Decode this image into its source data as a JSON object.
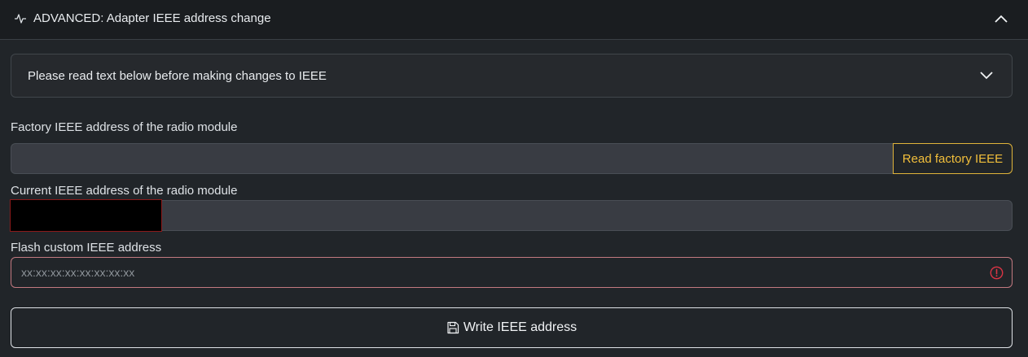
{
  "header": {
    "title": "ADVANCED: Adapter IEEE address change",
    "icon": "activity-pulse-icon",
    "toggle_icon": "chevron-up-icon"
  },
  "notice": {
    "text": "Please read text below before making changes to IEEE",
    "toggle_icon": "chevron-down-icon"
  },
  "factory": {
    "label": "Factory IEEE address of the radio module",
    "value": "",
    "button_label": "Read factory IEEE"
  },
  "current": {
    "label": "Current IEEE address of the radio module",
    "value": ""
  },
  "flash": {
    "label": "Flash custom IEEE address",
    "placeholder": "xx:xx:xx:xx:xx:xx:xx:xx",
    "value": "",
    "invalid": true
  },
  "write": {
    "button_label": "Write IEEE address",
    "icon": "floppy-disk-icon"
  },
  "colors": {
    "background": "#212529",
    "header": "#1a1d20",
    "warning": "#f2bf3b",
    "danger": "#dc3545"
  }
}
